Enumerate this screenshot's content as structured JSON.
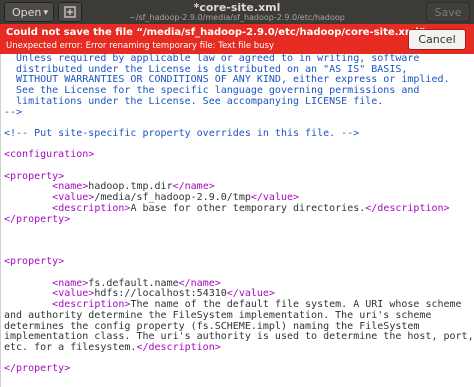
{
  "header": {
    "open_label": "Open",
    "title": "*core-site.xml",
    "subtitle": "~/sf_hadoop-2.9.0/media/sf_hadoop-2.9.0/etc/hadoop",
    "save_label": "Save",
    "open_chevron_icon": "chevron-down-icon",
    "new_tab_icon": "new-document-icon"
  },
  "error_bar": {
    "title": "Could not save the file “/media/sf_hadoop-2.9.0/etc/hadoop/core-site.xml”.",
    "detail": "Unexpected error: Error renaming temporary file: Text file busy",
    "cancel_label": "Cancel",
    "color": "#e62b22"
  },
  "editor": {
    "license_comment": [
      "  Unless required by applicable law or agreed to in writing, software",
      "  distributed under the License is distributed on an \"AS IS\" BASIS,",
      "  WITHOUT WARRANTIES OR CONDITIONS OF ANY KIND, either express or implied.",
      "  See the License for the specific language governing permissions and",
      "  limitations under the License. See accompanying LICENSE file.",
      "-->"
    ],
    "site_comment": "<!-- Put site-specific property overrides in this file. -->",
    "configuration_open": "<configuration>",
    "property_open": "<property>",
    "property_close": "</property>",
    "name_open": "<name>",
    "name_close": "</name>",
    "value_open": "<value>",
    "value_close": "</value>",
    "description_open": "<description>",
    "description_close": "</description>",
    "property1": {
      "name": "hadoop.tmp.dir",
      "value": "/media/sf_hadoop-2.9.0/tmp",
      "description": "A base for other temporary directories."
    },
    "property2": {
      "name": "fs.default.name",
      "value": "hdfs://localhost:54310",
      "description_lines": [
        "The name of the default file system. A URI whose scheme",
        "and authority determine the FileSystem implementation. The uri's scheme",
        "determines the config property (fs.SCHEME.impl) naming the FileSystem",
        "implementation class. The uri's authority is used to determine the host, port,",
        "etc. for a filesystem."
      ]
    }
  }
}
